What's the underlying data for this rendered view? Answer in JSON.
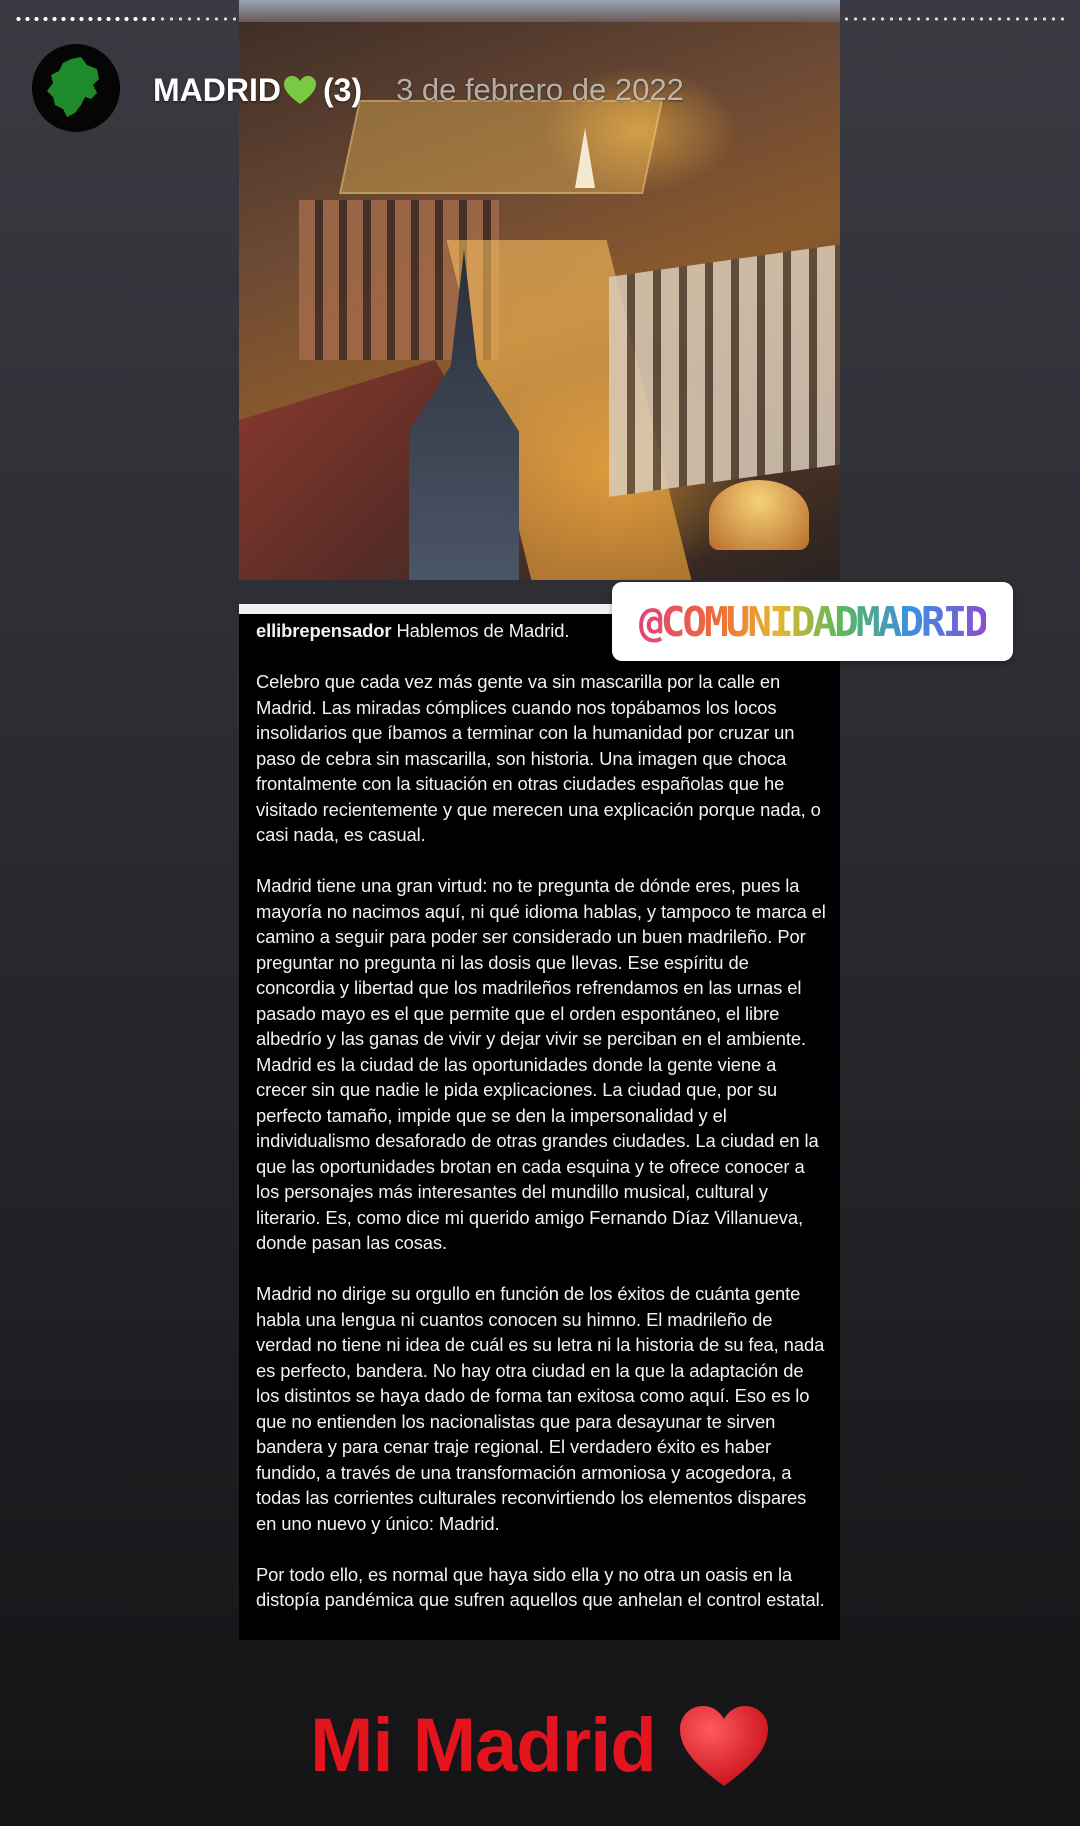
{
  "story": {
    "title": "MADRID",
    "count": "(3)",
    "date": "3 de febrero de 2022",
    "progress_segments": 1
  },
  "sticker": {
    "mention": "@COMUNIDADMADRID"
  },
  "post": {
    "username": "ellibrepensador",
    "paragraphs": [
      " Hablemos de Madrid.",
      "Celebro que cada vez más gente va sin mascarilla por la calle en Madrid. Las miradas cómplices cuando nos topábamos los locos insolidarios que íbamos a terminar con la humanidad por cruzar un paso de cebra sin mascarilla, son historia. Una imagen que choca frontalmente con la situación en otras ciudades españolas que he visitado recientemente y que merecen una explicación porque nada, o casi nada, es casual.",
      "Madrid tiene una gran virtud: no te pregunta de dónde eres, pues la mayoría no nacimos aquí, ni qué idioma hablas, y tampoco te marca el camino a seguir para poder ser considerado un buen madrileño. Por preguntar no pregunta ni las dosis que llevas. Ese espíritu de concordia y libertad que los madrileños refrendamos en las urnas el pasado mayo es el que permite que el orden espontáneo, el libre albedrío y las ganas de vivir y dejar vivir se perciban en el ambiente. Madrid es la ciudad de las oportunidades donde la gente viene a crecer sin que nadie le pida explicaciones. La ciudad que, por su perfecto tamaño, impide que se den la impersonalidad y el individualismo desaforado de otras grandes ciudades. La ciudad en la que las oportunidades brotan en cada esquina y te ofrece conocer a los personajes más interesantes del mundillo musical, cultural y literario. Es, como dice mi querido amigo Fernando Díaz Villanueva, donde pasan las cosas.",
      "Madrid no dirige su orgullo en función de los éxitos de cuánta gente habla una lengua ni cuantos conocen su himno. El madrileño de verdad no tiene ni idea de cuál es su letra ni la historia de su fea, nada es perfecto, bandera. No hay otra ciudad en la que la adaptación de los distintos se haya dado de forma tan exitosa como aquí. Eso es lo que no entienden los nacionalistas que para desayunar te sirven bandera y para cenar traje regional. El verdadero éxito es haber fundido, a través de una transformación armoniosa y acogedora, a todas las corrientes culturales reconvirtiendo los elementos dispares en uno nuevo y único: Madrid.",
      "Por todo ello, es normal que haya sido ella y no otra un oasis en la distopía pandémica que sufren aquellos que anhelan el control estatal."
    ]
  },
  "caption": {
    "text": "Mi Madrid"
  },
  "icons": {
    "avatar": "comunidad-de-madrid-map-icon",
    "title_heart": "green-heart-icon",
    "caption_heart": "red-heart-icon"
  },
  "colors": {
    "caption_red": "#e3141e",
    "heart_green": "#7ac943",
    "avatar_green": "#1f8a2c"
  }
}
